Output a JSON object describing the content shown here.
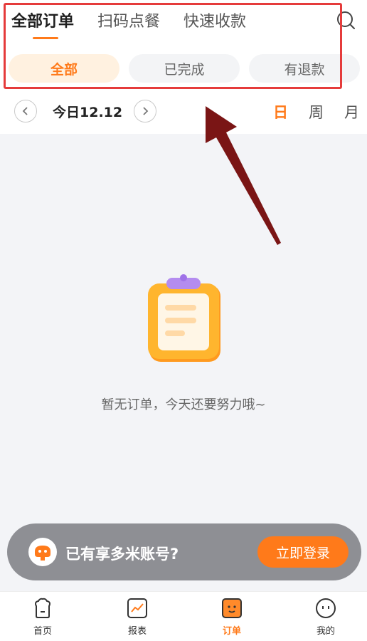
{
  "top_tabs": [
    {
      "label": "全部订单",
      "active": true
    },
    {
      "label": "扫码点餐",
      "active": false
    },
    {
      "label": "快速收款",
      "active": false
    }
  ],
  "search_icon": "search-icon",
  "filter_chips": [
    {
      "label": "全部",
      "active": true
    },
    {
      "label": "已完成",
      "active": false
    },
    {
      "label": "有退款",
      "active": false
    }
  ],
  "date_nav": {
    "prev_icon": "chevron-left-icon",
    "next_icon": "chevron-right-icon",
    "current_date": "今日12.12"
  },
  "period_toggle": [
    {
      "label": "日",
      "active": true
    },
    {
      "label": "周",
      "active": false
    },
    {
      "label": "月",
      "active": false
    }
  ],
  "empty_state": {
    "icon": "clipboard-icon",
    "message": "暂无订单，今天还要努力哦~"
  },
  "login_banner": {
    "text": "已有享多米账号?",
    "button": "立即登录"
  },
  "bottom_nav": [
    {
      "label": "首页",
      "icon": "home-chef-icon",
      "active": false
    },
    {
      "label": "报表",
      "icon": "report-chart-icon",
      "active": false
    },
    {
      "label": "订单",
      "icon": "order-icon",
      "active": true
    },
    {
      "label": "我的",
      "icon": "profile-icon",
      "active": false
    }
  ],
  "colors": {
    "accent": "#ff7a1a",
    "highlight": "#e53b3b",
    "arrow": "#7a1515",
    "background": "#f3f4f7"
  }
}
